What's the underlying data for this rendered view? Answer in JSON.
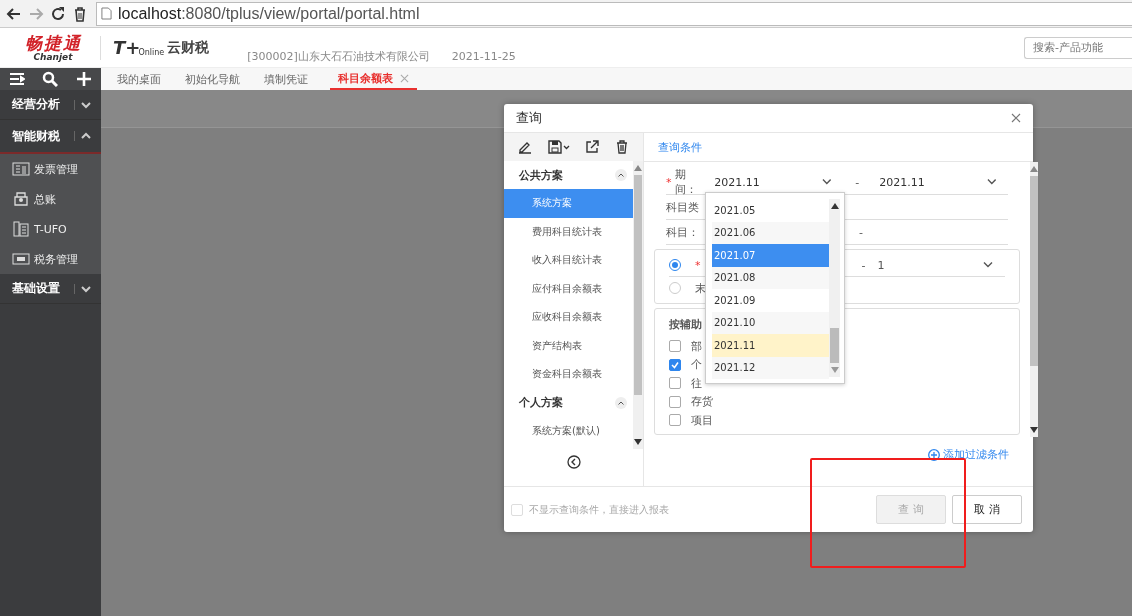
{
  "browser": {
    "url_host": "localhost",
    "url_rest": ":8080/tplus/view/portal/portal.html"
  },
  "header": {
    "brand": "畅捷通",
    "brand_sub": "Chanjet",
    "product_mark": "T+",
    "product_mark_sub": "Online",
    "product": "云财税",
    "company": "[300002]山东大石石油技术有限公司",
    "date": "2021-11-25",
    "search_placeholder": "搜索-产品功能"
  },
  "tabs": [
    {
      "label": "我的桌面",
      "selected": false,
      "closable": false
    },
    {
      "label": "初始化导航",
      "selected": false,
      "closable": false
    },
    {
      "label": "填制凭证",
      "selected": false,
      "closable": false
    },
    {
      "label": "科目余额表",
      "selected": true,
      "closable": true
    }
  ],
  "sidebar": {
    "groups": [
      {
        "label": "经营分析",
        "expanded": false
      },
      {
        "label": "智能财税",
        "expanded": true,
        "items": [
          {
            "label": "发票管理",
            "kind": "invoice"
          },
          {
            "label": "总账",
            "kind": "ledger"
          },
          {
            "label": "T-UFO",
            "kind": "report"
          },
          {
            "label": "税务管理",
            "kind": "tax"
          }
        ]
      },
      {
        "label": "基础设置",
        "expanded": false
      }
    ]
  },
  "dialog": {
    "title": "查询",
    "sections": [
      {
        "title": "公共方案",
        "expanded": true,
        "items": [
          {
            "label": "系统方案",
            "selected": true
          },
          {
            "label": "费用科目统计表",
            "selected": false
          },
          {
            "label": "收入科目统计表",
            "selected": false
          },
          {
            "label": "应付科目余额表",
            "selected": false
          },
          {
            "label": "应收科目余额表",
            "selected": false
          },
          {
            "label": "资产结构表",
            "selected": false
          },
          {
            "label": "资金科目余额表",
            "selected": false
          }
        ]
      },
      {
        "title": "个人方案",
        "expanded": true,
        "items": [
          {
            "label": "系统方案(默认)",
            "selected": false
          }
        ]
      }
    ],
    "tab": "查询条件",
    "fields": [
      {
        "label": "期间：",
        "required": true,
        "from": "2021.11",
        "separator": "-",
        "to": "2021.11"
      },
      {
        "label": "科目类"
      },
      {
        "label": "科目：",
        "separator": "-"
      }
    ],
    "level_box": {
      "options": [
        {
          "label": "*",
          "selected": true,
          "separator": "-",
          "to": "1"
        },
        {
          "label": "末",
          "selected": false
        }
      ]
    },
    "aux_box": {
      "title": "按辅助",
      "checks": [
        {
          "label": "部",
          "checked": false
        },
        {
          "label": "个",
          "checked": true
        },
        {
          "label": "往",
          "checked": false
        },
        {
          "label": "存货",
          "checked": false
        },
        {
          "label": "项目",
          "checked": false
        }
      ]
    },
    "add_filter": "添加过滤条件",
    "skip_option": {
      "label": "不显示查询条件，直接进入报表",
      "checked": false,
      "disabled": true
    },
    "buttons": [
      {
        "label": "查 询",
        "disabled": true
      },
      {
        "label": "取 消",
        "disabled": false
      }
    ]
  },
  "dropdown": {
    "options": [
      {
        "label": "2021.05",
        "selected": false,
        "current": false
      },
      {
        "label": "2021.06",
        "selected": false,
        "current": false
      },
      {
        "label": "2021.07",
        "selected": true,
        "current": false
      },
      {
        "label": "2021.08",
        "selected": false,
        "current": false
      },
      {
        "label": "2021.09",
        "selected": false,
        "current": false
      },
      {
        "label": "2021.10",
        "selected": false,
        "current": false
      },
      {
        "label": "2021.11",
        "selected": false,
        "current": true
      },
      {
        "label": "2021.12",
        "selected": false,
        "current": false
      }
    ]
  },
  "annotation": {
    "kind": "rectangle"
  }
}
